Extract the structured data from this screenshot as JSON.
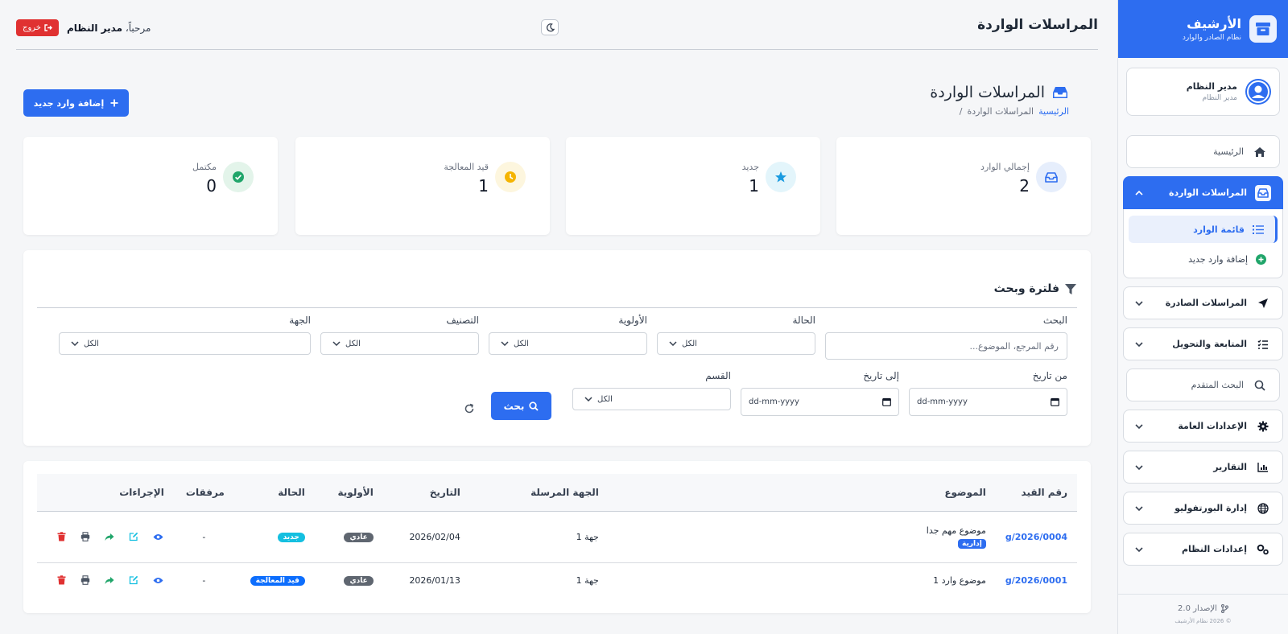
{
  "brand": {
    "title": "الأرشيف",
    "subtitle": "نظام الصادر والوارد"
  },
  "user": {
    "name": "مدير النظام",
    "role": "مدير النظام"
  },
  "nav": {
    "home": "الرئيسية",
    "incoming": "المراسلات الواردة",
    "incoming_list": "قائمة الوارد",
    "incoming_add": "إضافة وارد جديد",
    "outgoing": "المراسلات الصادرة",
    "followup": "المتابعة والتحويل",
    "advanced_search": "البحث المتقدم",
    "general_settings": "الإعدادات العامة",
    "reports": "التقارير",
    "portfolio": "إدارة البورتفوليو",
    "system_settings": "إعدادات النظام"
  },
  "footer": {
    "version": "الإصدار 2.0",
    "copyright": "© 2026 نظام الأرشيف"
  },
  "topbar": {
    "title": "المراسلات الواردة",
    "welcome_prefix": "مرحباً،",
    "welcome_name": "مدير النظام",
    "logout": "خروج"
  },
  "page": {
    "title": "المراسلات الواردة",
    "breadcrumb_home": "الرئيسية",
    "breadcrumb_current": "المراسلات الواردة",
    "breadcrumb_sep": "/",
    "add_button": "إضافة وارد جديد"
  },
  "stats": [
    {
      "label": "إجمالي الوارد",
      "value": "2"
    },
    {
      "label": "جديد",
      "value": "1"
    },
    {
      "label": "قيد المعالجة",
      "value": "1"
    },
    {
      "label": "مكتمل",
      "value": "0"
    }
  ],
  "filters": {
    "title": "فلترة وبحث",
    "search_label": "البحث",
    "search_placeholder": "رقم المرجع، الموضوع...",
    "status_label": "الحالة",
    "priority_label": "الأولوية",
    "category_label": "التصنيف",
    "entity_label": "الجهة",
    "all": "الكل",
    "from_date_label": "من تاريخ",
    "to_date_label": "إلى تاريخ",
    "department_label": "القسم",
    "date_placeholder": "dd-mm-yyyy",
    "search_button": "بحث"
  },
  "table": {
    "headers": {
      "ref": "رقم القيد",
      "subject": "الموضوع",
      "sender": "الجهة المرسلة",
      "date": "التاريخ",
      "priority": "الأولوية",
      "status": "الحالة",
      "attachments": "مرفقات",
      "actions": "الإجراءات"
    },
    "rows": [
      {
        "ref": "2026/0004/g",
        "subject": "موضوع مهم جدا",
        "type": "إدارية",
        "sender": "جهة 1",
        "date": "2026/02/04",
        "priority": "عادي",
        "status": "جديد",
        "attachments": "-"
      },
      {
        "ref": "2026/0001/g",
        "subject": "موضوع وارد 1",
        "type": "",
        "sender": "جهة 1",
        "date": "2026/01/13",
        "priority": "عادي",
        "status": "قيد المعالجة",
        "attachments": "-"
      }
    ]
  },
  "colors": {
    "primary": "#2d6df0",
    "danger": "#e03131",
    "success": "#20a56a",
    "warning": "#f5b400",
    "info": "#14bfe0"
  }
}
